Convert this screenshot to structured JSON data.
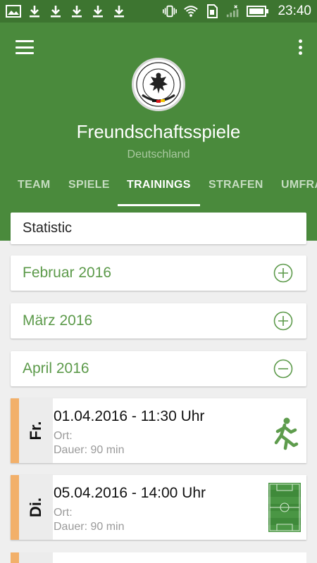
{
  "status_bar": {
    "time": "23:40",
    "icons": [
      "image-icon",
      "download-icon",
      "download-icon",
      "download-icon",
      "download-icon",
      "download-icon",
      "vibrate-icon",
      "wifi-icon",
      "sim-icon",
      "signal-icon",
      "battery-icon"
    ]
  },
  "header": {
    "title": "Freundschaftsspiele",
    "subtitle": "Deutschland",
    "logo_icon": "dfb-logo-icon",
    "colors": {
      "primary": "#4a8a3c",
      "status_bar": "#3d7530"
    }
  },
  "tabs": [
    {
      "label": "TEAM",
      "active": false
    },
    {
      "label": "SPIELE",
      "active": false
    },
    {
      "label": "TRAININGS",
      "active": true
    },
    {
      "label": "STRAFEN",
      "active": false
    },
    {
      "label": "UMFRA",
      "active": false
    }
  ],
  "statistic": {
    "label": "Statistic"
  },
  "months": [
    {
      "label": "Februar 2016",
      "expanded": false
    },
    {
      "label": "März 2016",
      "expanded": false
    },
    {
      "label": "April 2016",
      "expanded": true
    }
  ],
  "trainings": [
    {
      "day": "Fr.",
      "datetime": "01.04.2016 - 11:30 Uhr",
      "ort": "Ort:",
      "dauer": "Dauer: 90 min",
      "icon": "runner-icon"
    },
    {
      "day": "Di.",
      "datetime": "05.04.2016 - 14:00 Uhr",
      "ort": "Ort:",
      "dauer": "Dauer: 90 min",
      "icon": "football-pitch-icon"
    }
  ],
  "accent_colors": {
    "month_text": "#5c9a4a",
    "day_stripe": "#f2b06a"
  }
}
